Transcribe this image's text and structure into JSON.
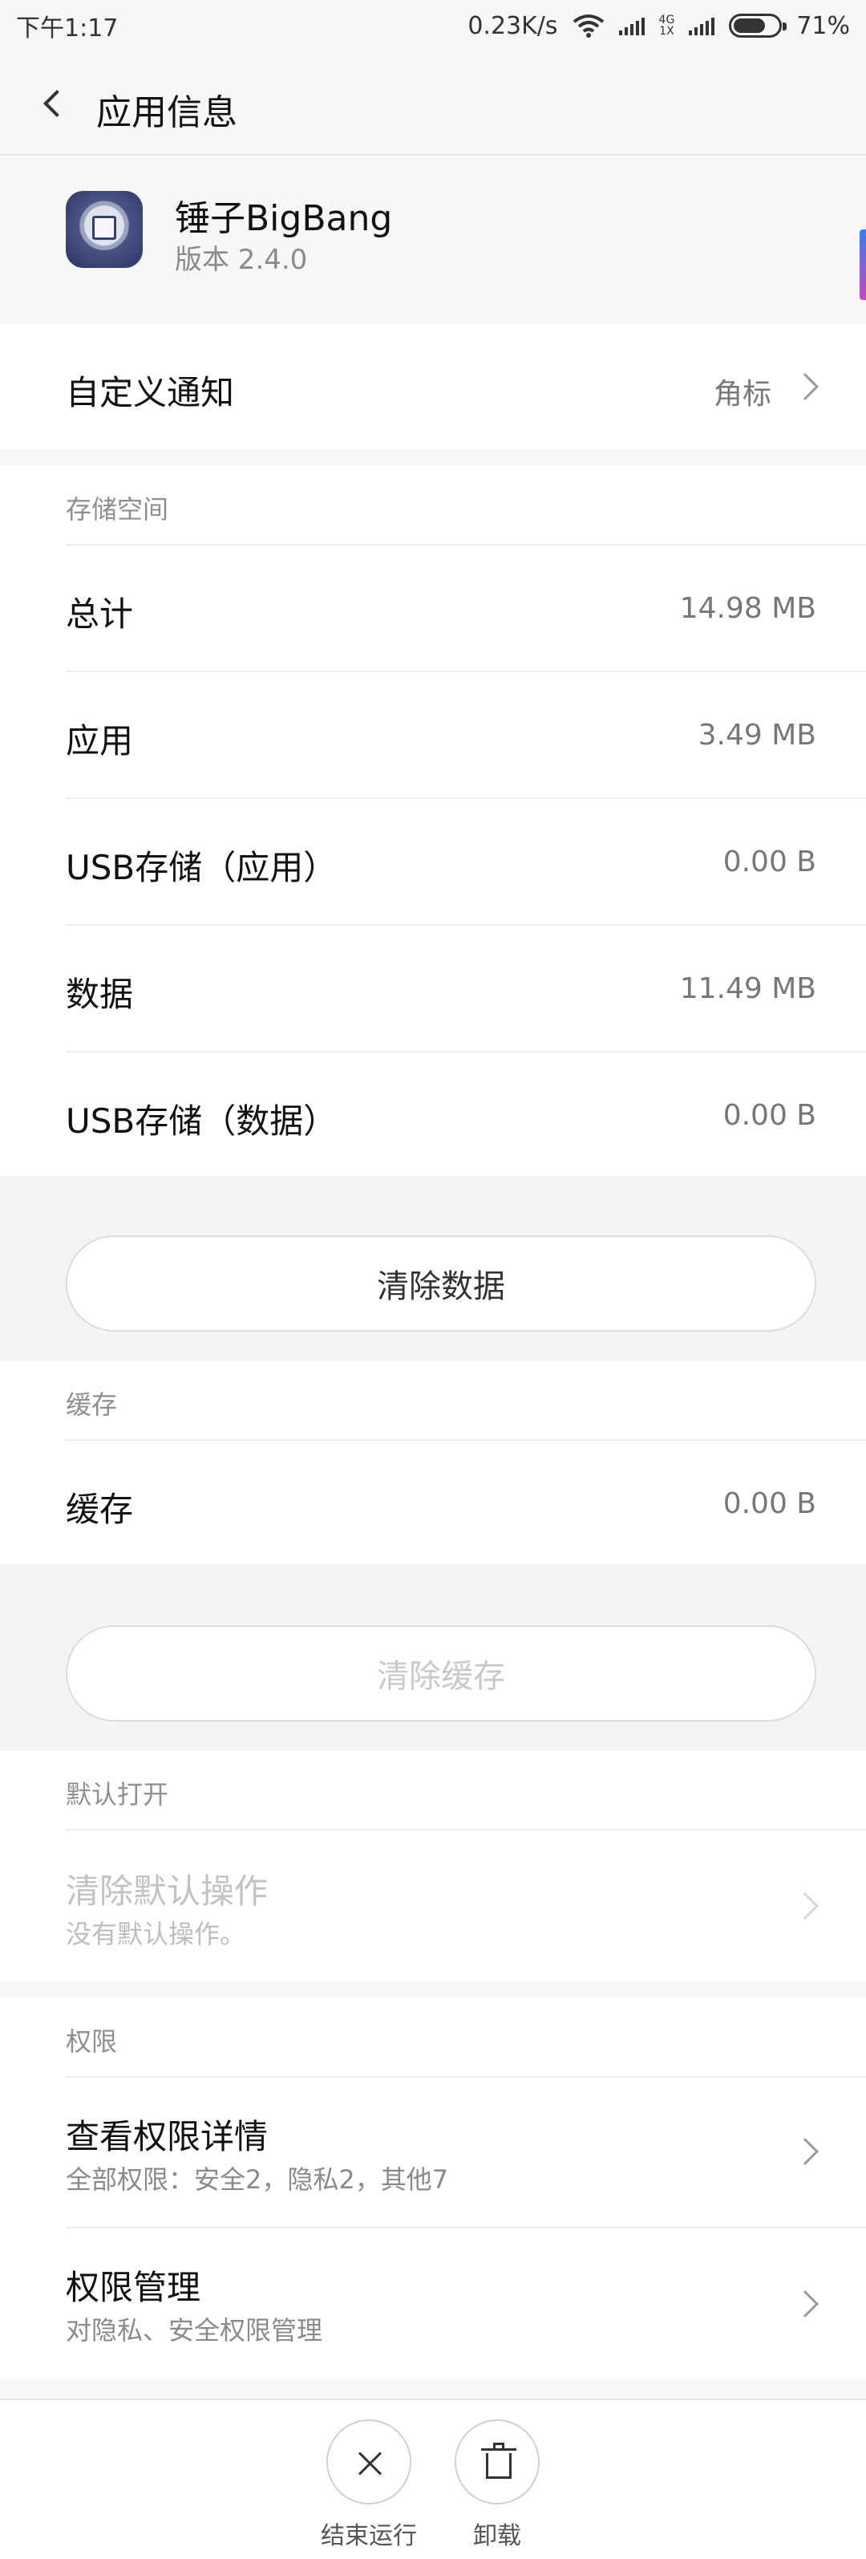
{
  "status_bar": {
    "time": "下午1:17",
    "speed": "0.23K/s",
    "network_top": "4G",
    "network_bottom": "1X",
    "battery": "71%",
    "battery_level": 0.71
  },
  "header": {
    "title": "应用信息"
  },
  "app": {
    "name": "锤子BigBang",
    "version": "版本 2.4.0"
  },
  "notification": {
    "label": "自定义通知",
    "value": "角标"
  },
  "storage": {
    "section_label": "存储空间",
    "rows": [
      {
        "label": "总计",
        "value": "14.98 MB"
      },
      {
        "label": "应用",
        "value": "3.49 MB"
      },
      {
        "label": "USB存储（应用）",
        "value": "0.00 B"
      },
      {
        "label": "数据",
        "value": "11.49 MB"
      },
      {
        "label": "USB存储（数据）",
        "value": "0.00 B"
      }
    ],
    "clear_button": "清除数据"
  },
  "cache": {
    "section_label": "缓存",
    "label": "缓存",
    "value": "0.00 B",
    "clear_button": "清除缓存"
  },
  "default_open": {
    "section_label": "默认打开",
    "title": "清除默认操作",
    "subtitle": "没有默认操作。"
  },
  "permissions": {
    "section_label": "权限",
    "items": [
      {
        "title": "查看权限详情",
        "subtitle": "全部权限：安全2，隐私2，其他7"
      },
      {
        "title": "权限管理",
        "subtitle": "对隐私、安全权限管理"
      }
    ]
  },
  "bottom_actions": {
    "force_stop": "结束运行",
    "uninstall": "卸载"
  },
  "colors": {
    "background": "#f7f7f7",
    "surface": "#ffffff",
    "text_primary": "#111111",
    "text_secondary": "#8a8a8a",
    "disabled": "#c9c9c9"
  }
}
